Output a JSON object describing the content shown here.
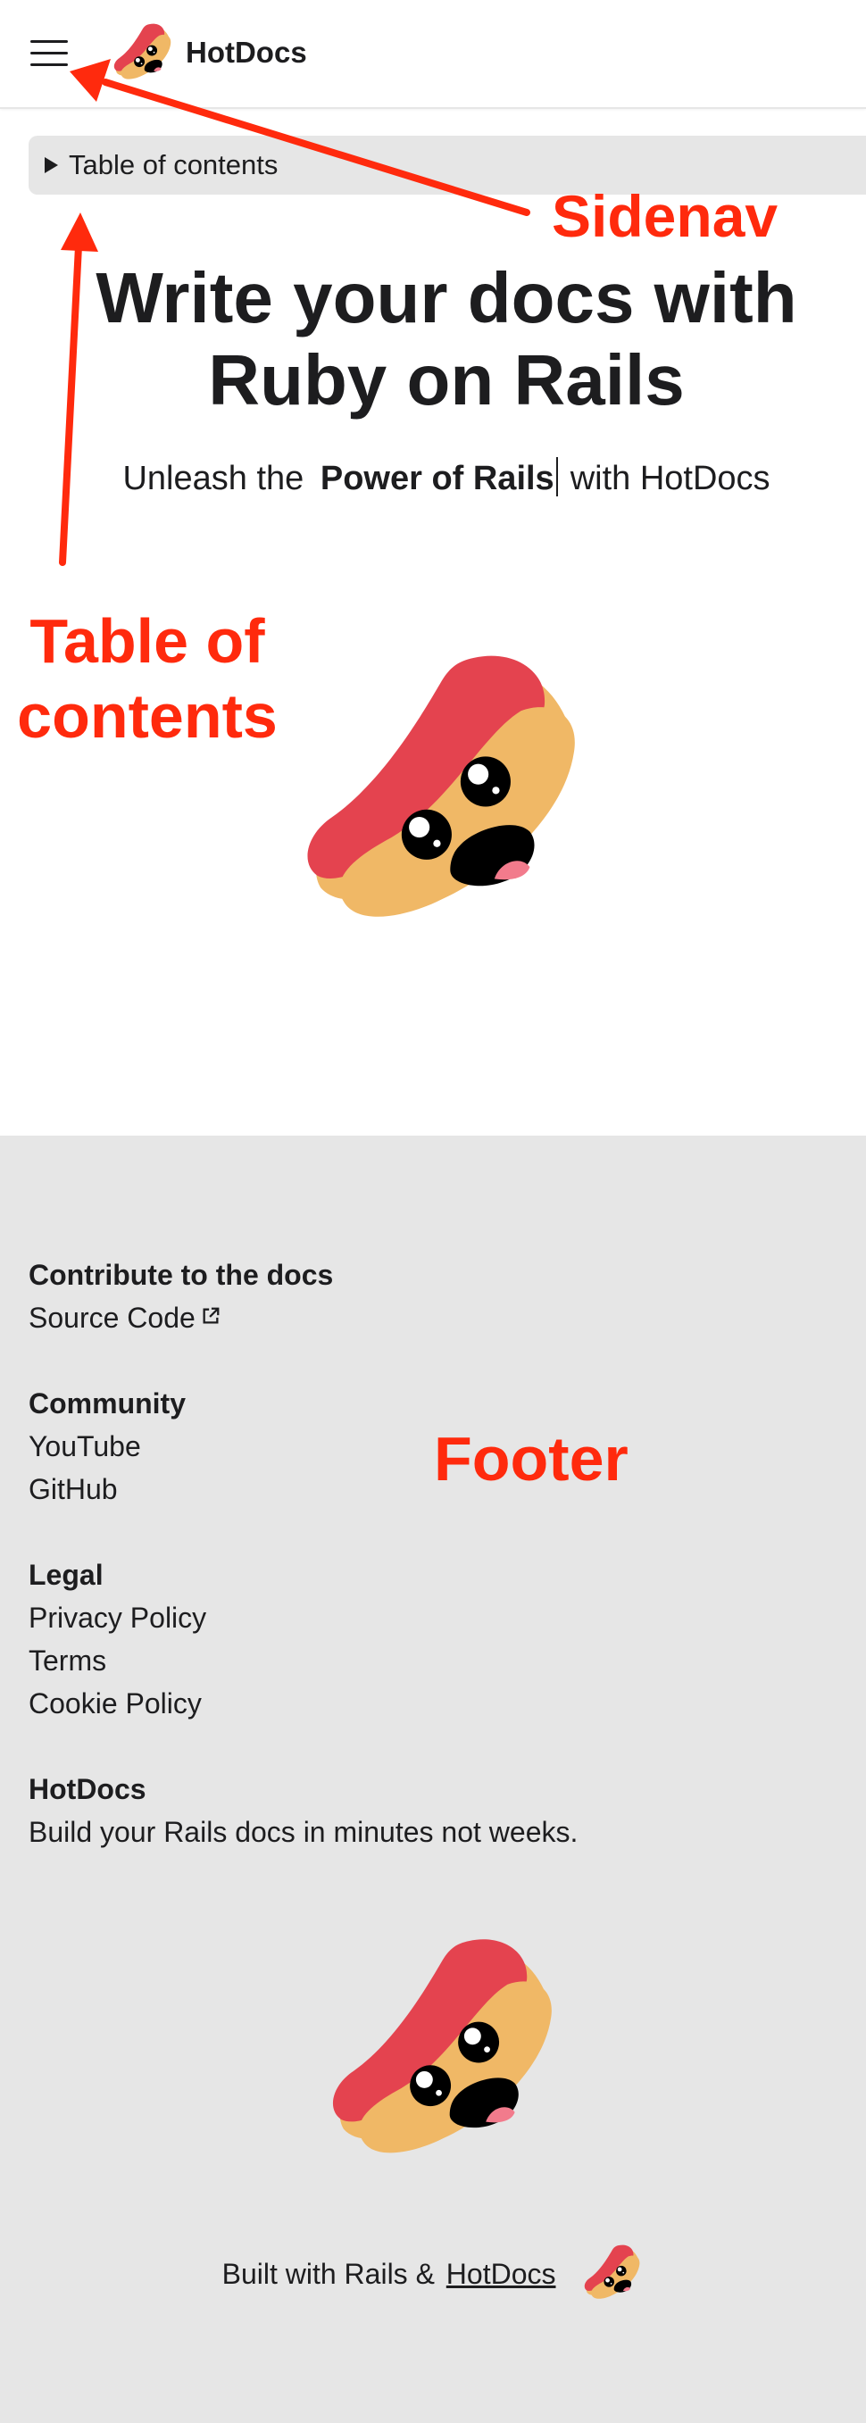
{
  "header": {
    "menu_icon": "hamburger-menu-icon",
    "brand_name": "HotDocs"
  },
  "toc": {
    "label": "Table of contents"
  },
  "hero": {
    "title_line1": "Write your docs with",
    "title_line2": "Ruby on Rails",
    "subtitle_prefix": "Unleash the",
    "subtitle_strong": "Power of Rails",
    "subtitle_suffix": "with HotDocs"
  },
  "footer": {
    "sections": [
      {
        "heading": "Contribute to the docs",
        "links": [
          "Source Code"
        ]
      },
      {
        "heading": "Community",
        "links": [
          "YouTube",
          "GitHub"
        ]
      },
      {
        "heading": "Legal",
        "links": [
          "Privacy Policy",
          "Terms",
          "Cookie Policy"
        ]
      },
      {
        "heading": "HotDocs",
        "text": "Build your Rails docs in minutes not weeks."
      }
    ],
    "built_with_prefix": "Built with Rails &",
    "built_with_link": "HotDocs"
  },
  "annotations": {
    "sidenav": "Sidenav",
    "toc_line1": "Table of",
    "toc_line2": "contents",
    "footer": "Footer"
  },
  "colors": {
    "annotation": "#ff2a0d",
    "footer_bg": "#e6e6e6",
    "toc_bg": "#e6e6e6",
    "text": "#1d1d1f",
    "mascot_bun": "#f0b866",
    "mascot_sausage": "#e4434f"
  }
}
